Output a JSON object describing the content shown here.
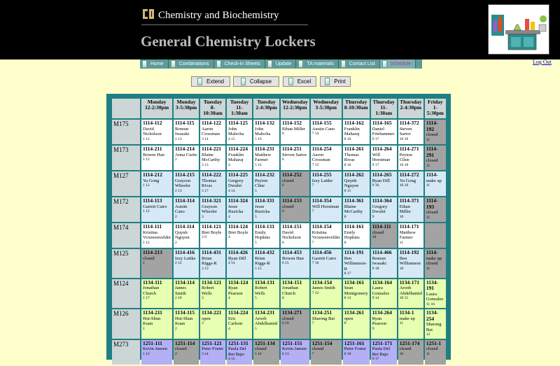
{
  "header": {
    "department": "Chemistry and Biochemistry",
    "title": "General Chemistry Lockers",
    "logout": "Log Out"
  },
  "nav": [
    "Home",
    "Combinations",
    "Check-in Sheets",
    "Update",
    "TA materials",
    "Contact List",
    "Schedule"
  ],
  "toolbar": {
    "extend": "Extend",
    "collapse": "Collapse",
    "excel": "Excel",
    "print": "Print"
  },
  "colors": {
    "header_bg": "#000000",
    "page_bg": "#ffffcc",
    "nav_bg": "#5e9a9a",
    "grid_border": "#1f7f82",
    "closed": "#a3a3a3",
    "green": "#e6ffb0",
    "purple": "#b5b0f5",
    "blue": "#d6e9f6",
    "link": "#0000cc"
  },
  "schedule": {
    "days": [
      {
        "d": "Monday",
        "t": "12-2:30pm"
      },
      {
        "d": "Monday",
        "t": "3-5:30pm"
      },
      {
        "d": "Tuesday",
        "t": "8-10:30am"
      },
      {
        "d": "Tuesday",
        "t": "11-1:30am"
      },
      {
        "d": "Tuesday",
        "t": "2-4:30pm"
      },
      {
        "d": "Wednesday",
        "t": "12-2:30pm"
      },
      {
        "d": "Wednesday",
        "t": "3-5:30pm"
      },
      {
        "d": "Thursday",
        "t": "8-10:30am"
      },
      {
        "d": "Thursday",
        "t": "11-1:30am"
      },
      {
        "d": "Thursday",
        "t": "2-4:30pm"
      },
      {
        "d": "Friday",
        "t": "1-5:30pm"
      }
    ],
    "rows": [
      {
        "room": "M175",
        "bg": "white",
        "cells": [
          {
            "l": "1114-112",
            "n": "David Nicholson",
            "c": "1 12"
          },
          {
            "l": "1114-115",
            "n": "Romun Iwasaki",
            "c": "2 13"
          },
          {
            "l": "1114-122",
            "n": "Aaron Crossman",
            "c": "3 14"
          },
          {
            "l": "1114-125",
            "n": "John Malecha",
            "c": "4 15"
          },
          {
            "l": "1114-132",
            "n": "John Malecha",
            "c": "5 16"
          },
          {
            "l": "1114-152",
            "n": "Ethan Miller",
            "c": "6"
          },
          {
            "l": "1114-155",
            "n": "Austin Cano",
            "c": "7 14"
          },
          {
            "l": "1114-162",
            "n": "Franklin Maharaj",
            "c": "8 16"
          },
          {
            "l": "1114-165",
            "n": "Daniel Friehammer",
            "c": "9 17"
          },
          {
            "l": "1114-372",
            "n": "Steven Sartor",
            "c": "10 18"
          },
          {
            "l": "1114-192",
            "n": "closed",
            "c": "11",
            "s": "closed"
          }
        ]
      },
      {
        "room": "M173",
        "bg": "white",
        "cells": [
          {
            "l": "1114-211",
            "n": "Bowen Han",
            "c": "1 12"
          },
          {
            "l": "1114-214",
            "n": "Anna Curtis",
            "c": "2"
          },
          {
            "l": "1114-221",
            "n": "Blaine McCarthy",
            "c": "3 13"
          },
          {
            "l": "1114-224",
            "n": "Franklin Maharaj",
            "c": "4"
          },
          {
            "l": "1114-231",
            "n": "Matthew Farmer",
            "c": "5 14"
          },
          {
            "l": "1114-251",
            "n": "Steven Sartor",
            "c": "6"
          },
          {
            "l": "1114-254",
            "n": "Aaron Crossman",
            "c": "7 15"
          },
          {
            "l": "1114-261",
            "n": "Thomas Rivas",
            "c": "8 16"
          },
          {
            "l": "1114-264",
            "n": "Will Horstman",
            "c": "9 17"
          },
          {
            "l": "1114-271",
            "n": "Peyton Cline",
            "c": "10 18"
          },
          {
            "l": "1114-291",
            "n": "closed",
            "c": "11",
            "s": "closed"
          }
        ]
      },
      {
        "room": "M127",
        "bg": "blue",
        "cells": [
          {
            "l": "1114-212",
            "n": "Yu Gong",
            "c": "1 12"
          },
          {
            "l": "1114-215",
            "n": "Grayson Wheeler",
            "c": "2 13"
          },
          {
            "l": "1114-222",
            "n": "Thomas Rivas",
            "c": "3 17"
          },
          {
            "l": "1114-225",
            "n": "Gregory Dwulet",
            "c": "4 14"
          },
          {
            "l": "1114-232",
            "n": "Peyton Cline",
            "c": "5"
          },
          {
            "l": "1114-252",
            "n": "closed",
            "c": "6",
            "s": "closed"
          },
          {
            "l": "1114-255",
            "n": "Izzy Lattke",
            "c": "7"
          },
          {
            "l": "1114-262",
            "n": "Quynh Nguyen",
            "c": "8 15"
          },
          {
            "l": "1114-265",
            "n": "Ryan Dill",
            "c": "9 16"
          },
          {
            "l": "1114-272",
            "n": "Yu Gong",
            "c": "10 18"
          },
          {
            "l": "1114-",
            "n": "make up",
            "c": "11"
          }
        ]
      },
      {
        "room": "M172",
        "bg": "blue",
        "cells": [
          {
            "l": "1114-113",
            "n": "Garrett Cairo",
            "c": "1 12"
          },
          {
            "l": "1114-314",
            "n": "Austin Cano",
            "c": "2"
          },
          {
            "l": "1114-321",
            "n": "Grayson Wheeler",
            "c": "3"
          },
          {
            "l": "1114-324",
            "n": "Jesse Ruzicka",
            "c": "4"
          },
          {
            "l": "1114-331",
            "n": "Jesse Ruzicka",
            "c": "5"
          },
          {
            "l": "1114-153",
            "n": "closed",
            "c": "6",
            "s": "closed"
          },
          {
            "l": "1114-354",
            "n": "Will Horstman",
            "c": "7"
          },
          {
            "l": "1114-361",
            "n": "Blaine McCarthy",
            "c": "8"
          },
          {
            "l": "1114-364",
            "n": "Gregory Dwulet",
            "c": "9"
          },
          {
            "l": "1114-371",
            "n": "Ethan Miller",
            "c": "10"
          },
          {
            "l": "1114-193",
            "n": "closed",
            "c": "11",
            "s": "closed"
          }
        ]
      },
      {
        "room": "M174",
        "bg": "white",
        "cells": [
          {
            "l": "1114-111",
            "n": "Kristina Vrouwenvelder",
            "c": "1 12"
          },
          {
            "l": "1114-114",
            "n": "Quynh Nguyen",
            "c": "2"
          },
          {
            "l": "1114-121",
            "n": "Bret Boyle",
            "c": "3 9"
          },
          {
            "l": "1114-124",
            "n": "Bret Boyle",
            "c": "4"
          },
          {
            "l": "1114-131",
            "n": "Emily Hopkins",
            "c": "5"
          },
          {
            "l": "1114-151",
            "n": "David Nicholson",
            "c": "6"
          },
          {
            "l": "1114-154",
            "n": "Kristina Vrouwenvelder",
            "c": "7"
          },
          {
            "l": "1114-161",
            "n": "Emily Hopkins",
            "c": "8"
          },
          {
            "l": "1114-111",
            "n": "closed",
            "c": "10",
            "s": "closed"
          },
          {
            "l": "1114-171",
            "n": "Matthew Farmer",
            "c": "11"
          },
          {
            "l": "",
            "n": "",
            "c": "",
            "s": "closed"
          }
        ]
      },
      {
        "room": "M125",
        "bg": "blue",
        "cells": [
          {
            "l": "1114-213",
            "n": "closed",
            "c": "1",
            "s": "closed"
          },
          {
            "l": "1114-416",
            "n": "Izzy Lattke",
            "c": "2 12"
          },
          {
            "l": "1114-431",
            "n": "Brian Riggs-R",
            "c": "3 13"
          },
          {
            "l": "1114-426",
            "n": "Ryan Dill",
            "c": "4 14"
          },
          {
            "l": "1114-432",
            "n": "Brian Riggs-R",
            "c": "5 15"
          },
          {
            "l": "1114-453",
            "n": "Bowen Han",
            "c": "6 15"
          },
          {
            "l": "1114-456",
            "n": "Garrett Cairo",
            "c": "7 16"
          },
          {
            "l": "1114-191",
            "n": "Ben Williamson-R",
            "c": "8 17"
          },
          {
            "l": "1114-466",
            "n": "Romun Iwasaki",
            "c": "9 18"
          },
          {
            "l": "1114-192",
            "n": "Ben Williamson",
            "c": "10"
          },
          {
            "l": "1114-",
            "n": "make up closed",
            "c": "11",
            "s": "closed"
          }
        ]
      },
      {
        "room": "M124",
        "bg": "green",
        "cells": [
          {
            "l": "1134-111",
            "n": "Jonathan Church",
            "c": "1 17"
          },
          {
            "l": "1134-114",
            "n": "James Smith",
            "c": "2 18"
          },
          {
            "l": "1134-121",
            "n": "Robert Wells",
            "c": "3"
          },
          {
            "l": "1134-124",
            "n": "Ryan Pearson",
            "c": "4"
          },
          {
            "l": "1134-131",
            "n": "Robert Wells",
            "c": "5"
          },
          {
            "l": "1134-151",
            "n": "Jonathan Church",
            "c": "6"
          },
          {
            "l": "1134-154",
            "n": "James Smith",
            "c": "7 12"
          },
          {
            "l": "1134-161",
            "n": "Sean Montgomery",
            "c": "8 13"
          },
          {
            "l": "1134-164",
            "n": "Laura Gonzalez",
            "c": "9 14"
          },
          {
            "l": "1134-171",
            "n": "Aroob Abdelhamid",
            "c": "10 15"
          },
          {
            "l": "1134-191",
            "n": "Laura Gonzalez",
            "c": "11 16"
          }
        ]
      },
      {
        "room": "M126",
        "bg": "green",
        "cells": [
          {
            "l": "1134-211",
            "n": "Hui-Shun Kuan",
            "c": "1"
          },
          {
            "l": "1134-115",
            "n": "Hui-Shun Kuan",
            "c": "2"
          },
          {
            "l": "1134-221",
            "n": "open",
            "c": "3"
          },
          {
            "l": "1134-224",
            "n": "Eric Carlson",
            "c": "4"
          },
          {
            "l": "1134-231",
            "n": "Aroob Abdelhamid",
            "c": "5"
          },
          {
            "l": "1134-271",
            "n": "closed",
            "c": "6 10",
            "s": "closed"
          },
          {
            "l": "1134-251",
            "n": "Sharong Bai",
            "c": "7"
          },
          {
            "l": "1134-261",
            "n": "open",
            "c": "8"
          },
          {
            "l": "1134-264",
            "n": "Ryan Pearson",
            "c": "9"
          },
          {
            "l": "1134-1",
            "n": "make up",
            "c": "11"
          },
          {
            "l": "1134-254",
            "n": "Sharong Bai",
            "c": "12"
          }
        ]
      },
      {
        "room": "M273",
        "bg": "purple",
        "cells": [
          {
            "l": "1251-111",
            "n": "Kevin Jansen",
            "c": "1 12"
          },
          {
            "l": "1251-114",
            "n": "closed",
            "c": "2",
            "s": "closed"
          },
          {
            "l": "1251-121",
            "n": "Peter Foster",
            "c": "3 14"
          },
          {
            "l": "1251-131",
            "n": "Paula Del Rei Bajo",
            "c": "4 15"
          },
          {
            "l": "1251-134",
            "n": "closed",
            "c": "5 16",
            "s": "closed"
          },
          {
            "l": "1251-151",
            "n": "Kevin Jansen",
            "c": "6 13"
          },
          {
            "l": "1251-154",
            "n": "closed",
            "c": "7",
            "s": "closed"
          },
          {
            "l": "1251-161",
            "n": "Peter Foster",
            "c": "8 18"
          },
          {
            "l": "1251-171",
            "n": "Paula Del Rei Bajo",
            "c": "9 17"
          },
          {
            "l": "1251-174",
            "n": "closed",
            "c": "10",
            "s": "closed"
          },
          {
            "l": "1251-1",
            "n": "closed",
            "c": "11",
            "s": "closed"
          }
        ]
      }
    ]
  }
}
